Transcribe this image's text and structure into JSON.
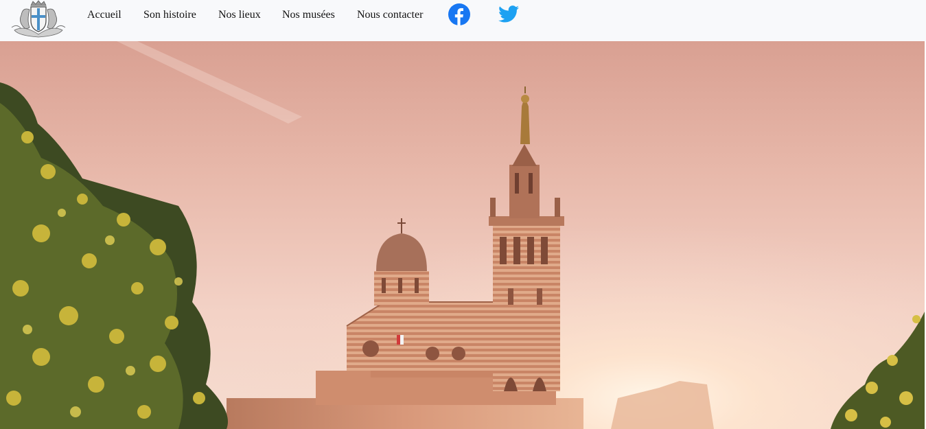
{
  "nav": {
    "logo_icon": "city-coat-of-arms-icon",
    "links": [
      {
        "label": "Accueil"
      },
      {
        "label": "Son histoire"
      },
      {
        "label": "Nos lieux"
      },
      {
        "label": "Nos musées"
      },
      {
        "label": "Nous contacter"
      }
    ],
    "social": [
      {
        "icon": "facebook-icon",
        "color": "#1877f2"
      },
      {
        "icon": "twitter-icon",
        "color": "#1da1f2"
      }
    ]
  },
  "hero": {
    "image": "basilica-on-hill-at-sunset-photo"
  },
  "colors": {
    "navbar_bg": "#f8f9fb",
    "sky": "#e8b6a6",
    "stone": "#d99a75"
  }
}
